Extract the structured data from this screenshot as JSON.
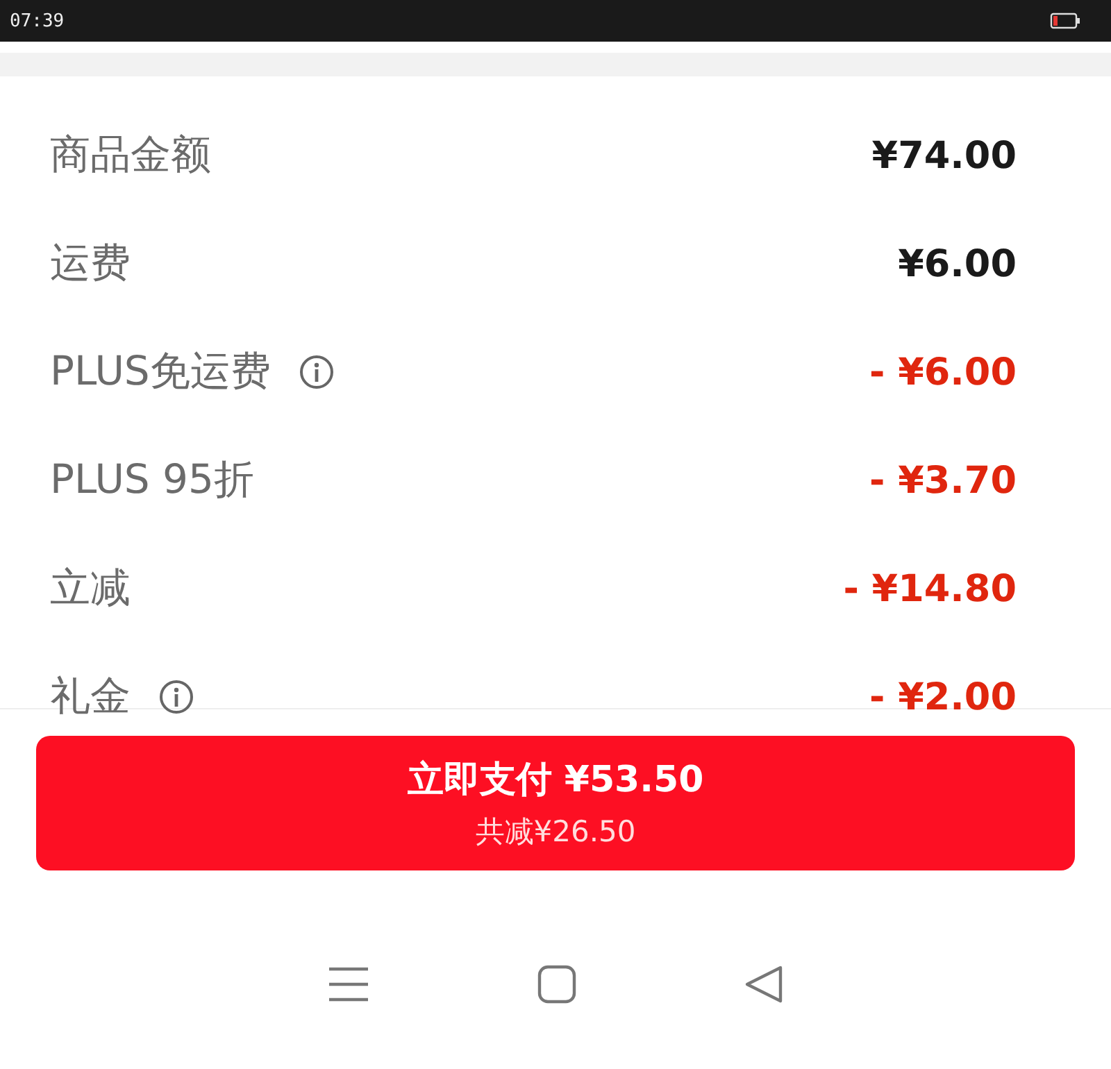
{
  "status_bar": {
    "time": "07:39"
  },
  "rows": [
    {
      "label": "商品金额",
      "info": false,
      "kind": "charge",
      "amount": "¥74.00"
    },
    {
      "label": "运费",
      "info": false,
      "kind": "charge",
      "amount": "¥6.00"
    },
    {
      "label": "PLUS免运费",
      "info": true,
      "kind": "discount",
      "amount": "- ¥6.00"
    },
    {
      "label": "PLUS 95折",
      "info": false,
      "kind": "discount",
      "amount": "- ¥3.70"
    },
    {
      "label": "立减",
      "info": false,
      "kind": "discount",
      "amount": "- ¥14.80"
    },
    {
      "label": "礼金",
      "info": true,
      "kind": "discount",
      "amount": "- ¥2.00"
    }
  ],
  "pay_button": {
    "label": "立即支付 ¥53.50",
    "savings": "共减¥26.50"
  }
}
